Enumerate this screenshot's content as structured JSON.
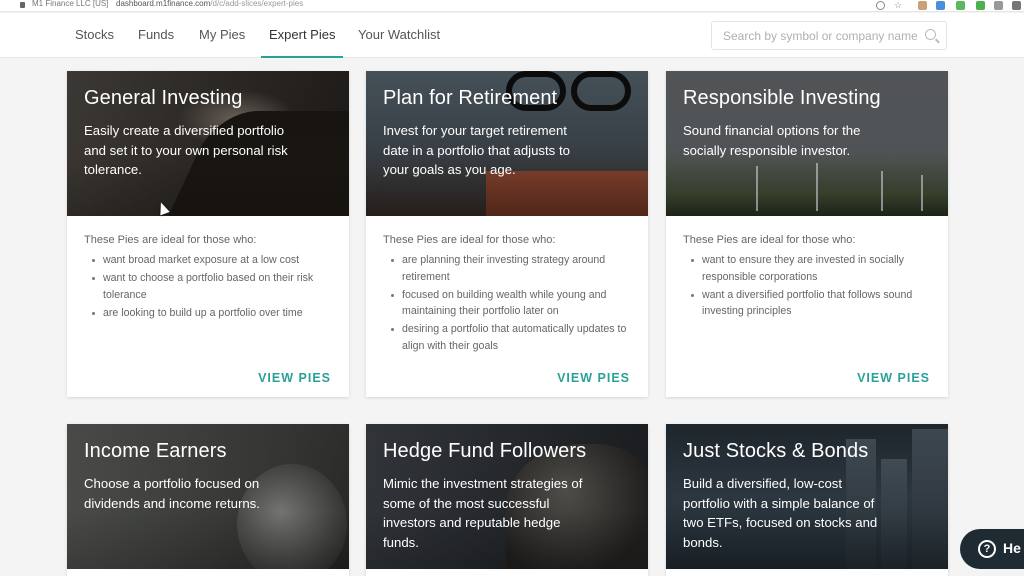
{
  "browser": {
    "site_label": "M1 Finance LLC [US]",
    "url_domain": "dashboard.m1finance.com",
    "url_path": "/d/c/add-slices/expert-pies"
  },
  "nav": {
    "tabs": [
      {
        "label": "Stocks"
      },
      {
        "label": "Funds"
      },
      {
        "label": "My Pies"
      },
      {
        "label": "Expert Pies",
        "active": true
      },
      {
        "label": "Your Watchlist"
      }
    ],
    "search_placeholder": "Search by symbol or company name"
  },
  "accent_color": "#2aa198",
  "cards": [
    {
      "title": "General Investing",
      "description": "Easily create a diversified portfolio and set it to your own personal risk tolerance.",
      "intro": "These Pies are ideal for those who:",
      "bullets": [
        "want broad market exposure at a low cost",
        "want to choose a portfolio based on their risk tolerance",
        "are looking to build up a portfolio over time"
      ],
      "link": "VIEW PIES"
    },
    {
      "title": "Plan for Retirement",
      "description": "Invest for your target retirement date in a portfolio that adjusts to your goals as you age.",
      "intro": "These Pies are ideal for those who:",
      "bullets": [
        "are planning their investing strategy around retirement",
        "focused on building wealth while young and maintaining their portfolio later on",
        "desiring a portfolio that automatically updates to align with their goals"
      ],
      "link": "VIEW PIES"
    },
    {
      "title": "Responsible Investing",
      "description": "Sound financial options for the socially responsible investor.",
      "intro": "These Pies are ideal for those who:",
      "bullets": [
        "want to ensure they are invested in socially responsible corporations",
        "want a diversified portfolio that follows sound investing principles"
      ],
      "link": "VIEW PIES"
    },
    {
      "title": "Income Earners",
      "description": "Choose a portfolio focused on dividends and income returns."
    },
    {
      "title": "Hedge Fund Followers",
      "description": "Mimic the investment strategies of some of the most successful investors and reputable hedge funds."
    },
    {
      "title": "Just Stocks & Bonds",
      "description": "Build a diversified, low-cost portfolio with a simple balance of two ETFs, focused on stocks and bonds."
    }
  ],
  "help": {
    "label": "He"
  }
}
